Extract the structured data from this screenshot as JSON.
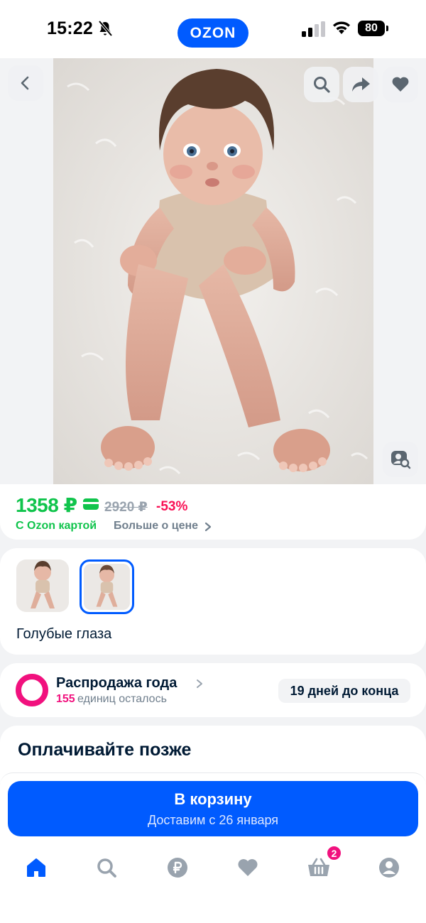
{
  "status_bar": {
    "time": "15:22",
    "battery": "80",
    "logo": "OZON"
  },
  "gallery": {
    "icons": [
      "back-icon",
      "search-icon",
      "share-icon",
      "heart-icon",
      "photo-search-icon"
    ]
  },
  "price": {
    "current": "1358 ₽",
    "old": "2920 ₽",
    "discount": "-53%",
    "with_card": "С Ozon картой",
    "more": "Больше о цене"
  },
  "variant": {
    "selected_label": "Голубые глаза",
    "thumb_count": 2,
    "selected_index": 1
  },
  "sale": {
    "title": "Распродажа года",
    "count": "155",
    "count_text": "единиц осталось",
    "deadline": "19 дней до конца"
  },
  "pay_later": {
    "title": "Оплачивайте позже"
  },
  "cart_button": {
    "title": "В корзину",
    "subtitle": "Доставим с 26 января"
  },
  "tabbar": {
    "items": [
      "home-icon",
      "search-icon",
      "ruble-icon",
      "heart-icon",
      "cart-icon",
      "profile-icon"
    ],
    "cart_badge": "2",
    "active": "home-icon"
  },
  "colors": {
    "brand": "#005bff",
    "price_green": "#10c44c",
    "discount_red": "#f91155",
    "accent_pink": "#f1117e"
  }
}
